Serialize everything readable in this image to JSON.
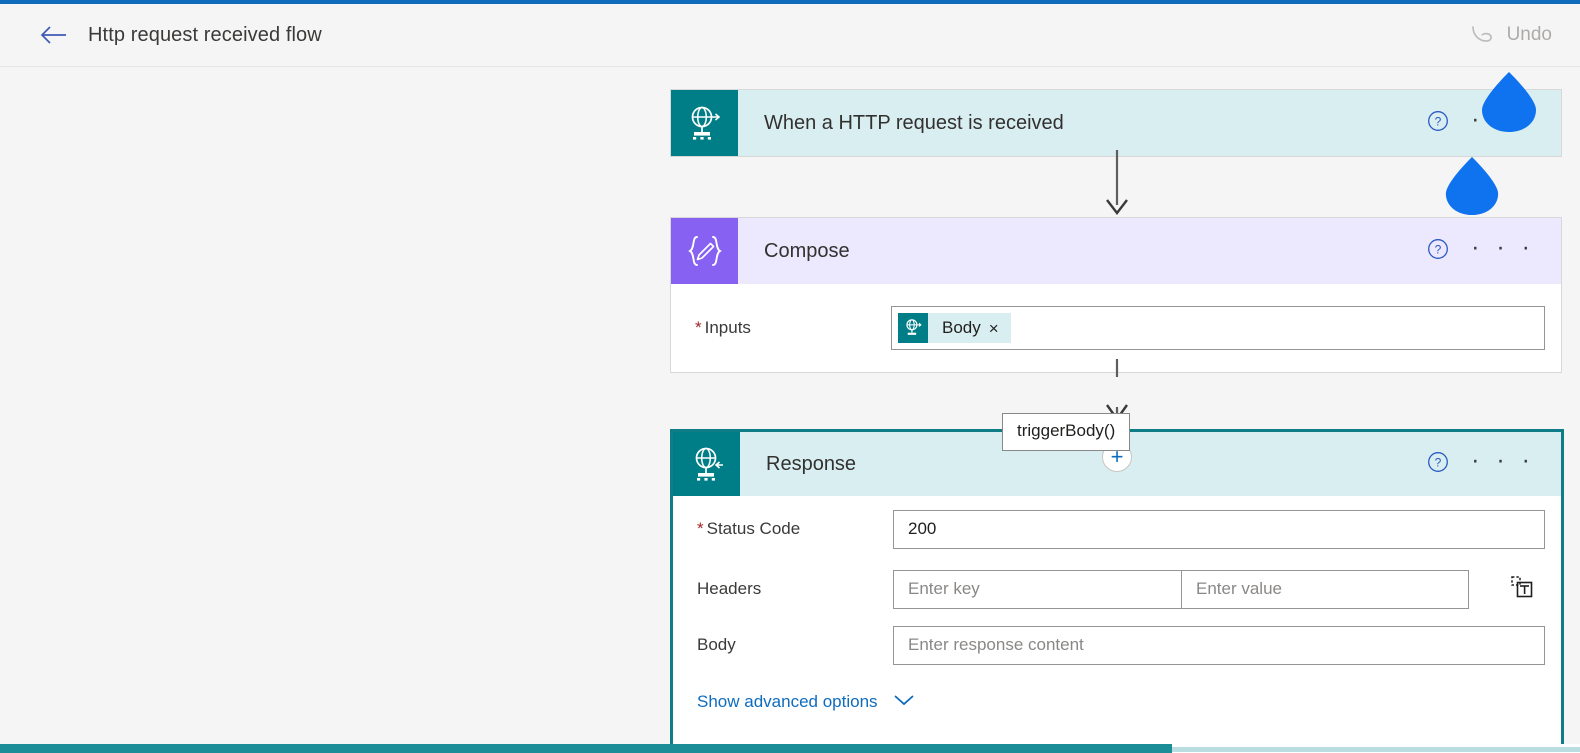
{
  "header": {
    "back_icon": "arrow-left-icon",
    "title": "Http request received flow",
    "undo_label": "Undo",
    "undo_icon": "undo-icon",
    "accent_color": "#0f6cbd",
    "undo_disabled_color": "#a19f9d"
  },
  "canvas": {
    "background_color": "#f5f5f5"
  },
  "cards": [
    {
      "id": "trigger",
      "title": "When a HTTP request is received",
      "icon": "http-request-globe-icon",
      "icon_bg": "#007e88",
      "header_bg": "#d9eef1",
      "help_icon": "help-circle-icon",
      "menu_icon": "ellipsis-icon",
      "menu_label": "· · ·"
    },
    {
      "id": "compose",
      "title": "Compose",
      "icon": "compose-braces-pencil-icon",
      "icon_bg": "#8661f2",
      "header_bg": "#ece8fd",
      "help_icon": "help-circle-icon",
      "menu_icon": "ellipsis-icon",
      "menu_label": "· · ·",
      "inputs_label": "Inputs",
      "inputs_required": "*",
      "token": {
        "label": "Body",
        "icon": "http-request-globe-icon",
        "icon_bg": "#007e88",
        "chip_bg": "#d9eef1",
        "remove_icon": "close-icon",
        "remove_glyph": "×"
      }
    },
    {
      "id": "response",
      "title": "Response",
      "icon": "http-response-globe-icon",
      "icon_bg": "#007e88",
      "header_bg": "#d9eef1",
      "selected_border_color": "#0f7c86",
      "help_icon": "help-circle-icon",
      "menu_icon": "ellipsis-icon",
      "menu_label": "· · ·",
      "fields": [
        {
          "label": "Status Code",
          "required": "*",
          "value": "200",
          "is_placeholder": false
        },
        {
          "label": "Headers",
          "required": "",
          "key_placeholder": "Enter key",
          "value_placeholder": "Enter value",
          "delete_icon": "delete-row-icon"
        },
        {
          "label": "Body",
          "required": "",
          "value": "Enter response content",
          "is_placeholder": true
        }
      ],
      "advanced_link": "Show advanced options",
      "advanced_chevron": "chevron-down-icon"
    }
  ],
  "tooltip": {
    "text": "triggerBody()"
  },
  "connectors": {
    "add_step_glyph": "+",
    "add_step_icon": "plus-circle-icon",
    "arrow_icon": "arrow-down-icon",
    "arrow_color": "#605e5c"
  },
  "markers": [
    {
      "name": "droplet-marker-1",
      "color": "#0f72ee"
    },
    {
      "name": "droplet-marker-2",
      "color": "#0f72ee"
    }
  ],
  "scrollbar": {
    "orientation": "horizontal",
    "thumb_color": "#1b8d97"
  }
}
